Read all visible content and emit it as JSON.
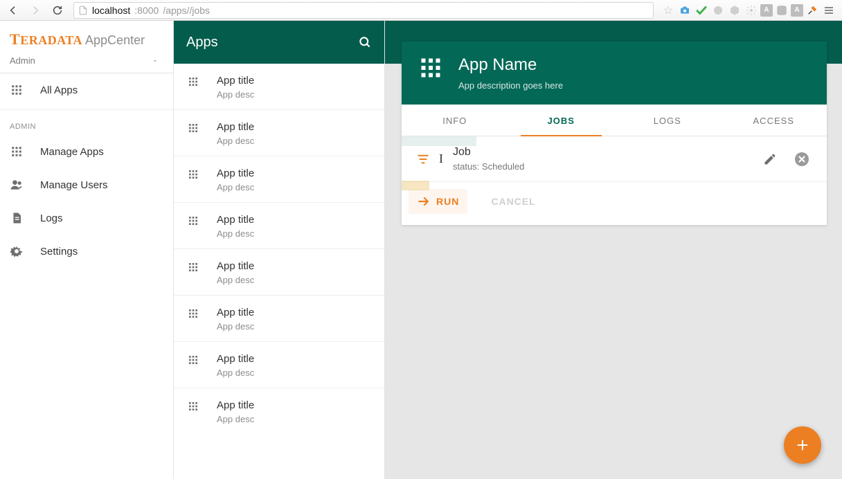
{
  "browser": {
    "url_host": "localhost",
    "url_port": ":8000",
    "url_path": "/apps//jobs"
  },
  "brand": {
    "logo": "TERADATA",
    "product": "AppCenter",
    "user": "Admin"
  },
  "sidebar": {
    "allApps": "All Apps",
    "sectionLabel": "ADMIN",
    "items": [
      {
        "label": "Manage Apps"
      },
      {
        "label": "Manage Users"
      },
      {
        "label": "Logs"
      },
      {
        "label": "Settings"
      }
    ]
  },
  "appbar": {
    "title": "Apps"
  },
  "appList": [
    {
      "title": "App title",
      "desc": "App desc"
    },
    {
      "title": "App title",
      "desc": "App desc"
    },
    {
      "title": "App title",
      "desc": "App desc"
    },
    {
      "title": "App title",
      "desc": "App desc"
    },
    {
      "title": "App title",
      "desc": "App desc"
    },
    {
      "title": "App title",
      "desc": "App desc"
    },
    {
      "title": "App title",
      "desc": "App desc"
    },
    {
      "title": "App title",
      "desc": "App desc"
    }
  ],
  "detail": {
    "title": "App Name",
    "subtitle": "App description goes here",
    "tabs": {
      "info": "INFO",
      "jobs": "JOBS",
      "logs": "LOGS",
      "access": "ACCESS"
    },
    "job": {
      "title": "Job",
      "statusLabel": "status: ",
      "statusValue": "Scheduled"
    },
    "actions": {
      "run": "RUN",
      "cancel": "CANCEL"
    }
  }
}
